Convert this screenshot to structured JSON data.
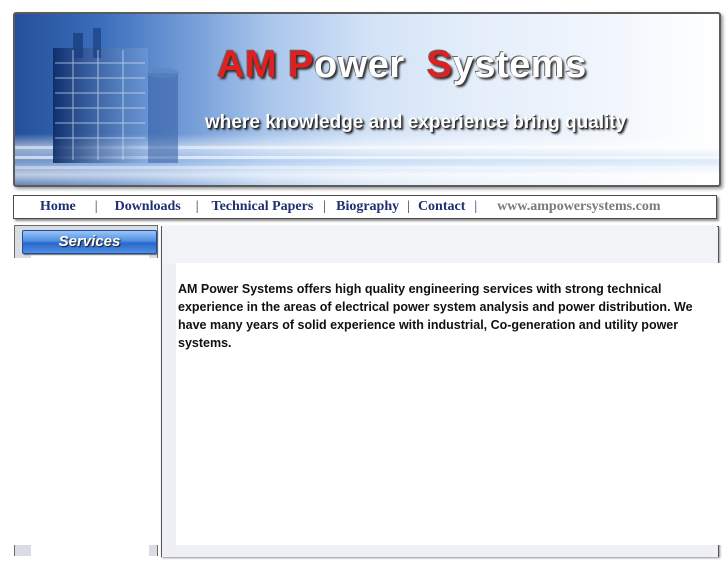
{
  "banner": {
    "title_parts": {
      "a": "AM",
      "b": "P",
      "c": "ower",
      "d": "S",
      "e": "ystems"
    },
    "tagline": "where knowledge and experience bring quality",
    "image": "power-plant-photo"
  },
  "nav": {
    "home": "Home",
    "downloads": "Downloads",
    "technical_papers": "Technical Papers",
    "biography": "Biography",
    "contact": "Contact",
    "separator": "|",
    "site": "www.ampowersystems.com"
  },
  "sidebar": {
    "header": "Services"
  },
  "content": {
    "intro": "AM Power Systems offers high quality engineering services with strong technical experience in the areas of electrical power system analysis and power distribution. We have many years of solid experience with industrial, Co-generation and utility power systems."
  },
  "colors": {
    "nav_link": "#1f2f6f",
    "title_red": "#e02020",
    "banner_blue": "#3a6dba"
  }
}
